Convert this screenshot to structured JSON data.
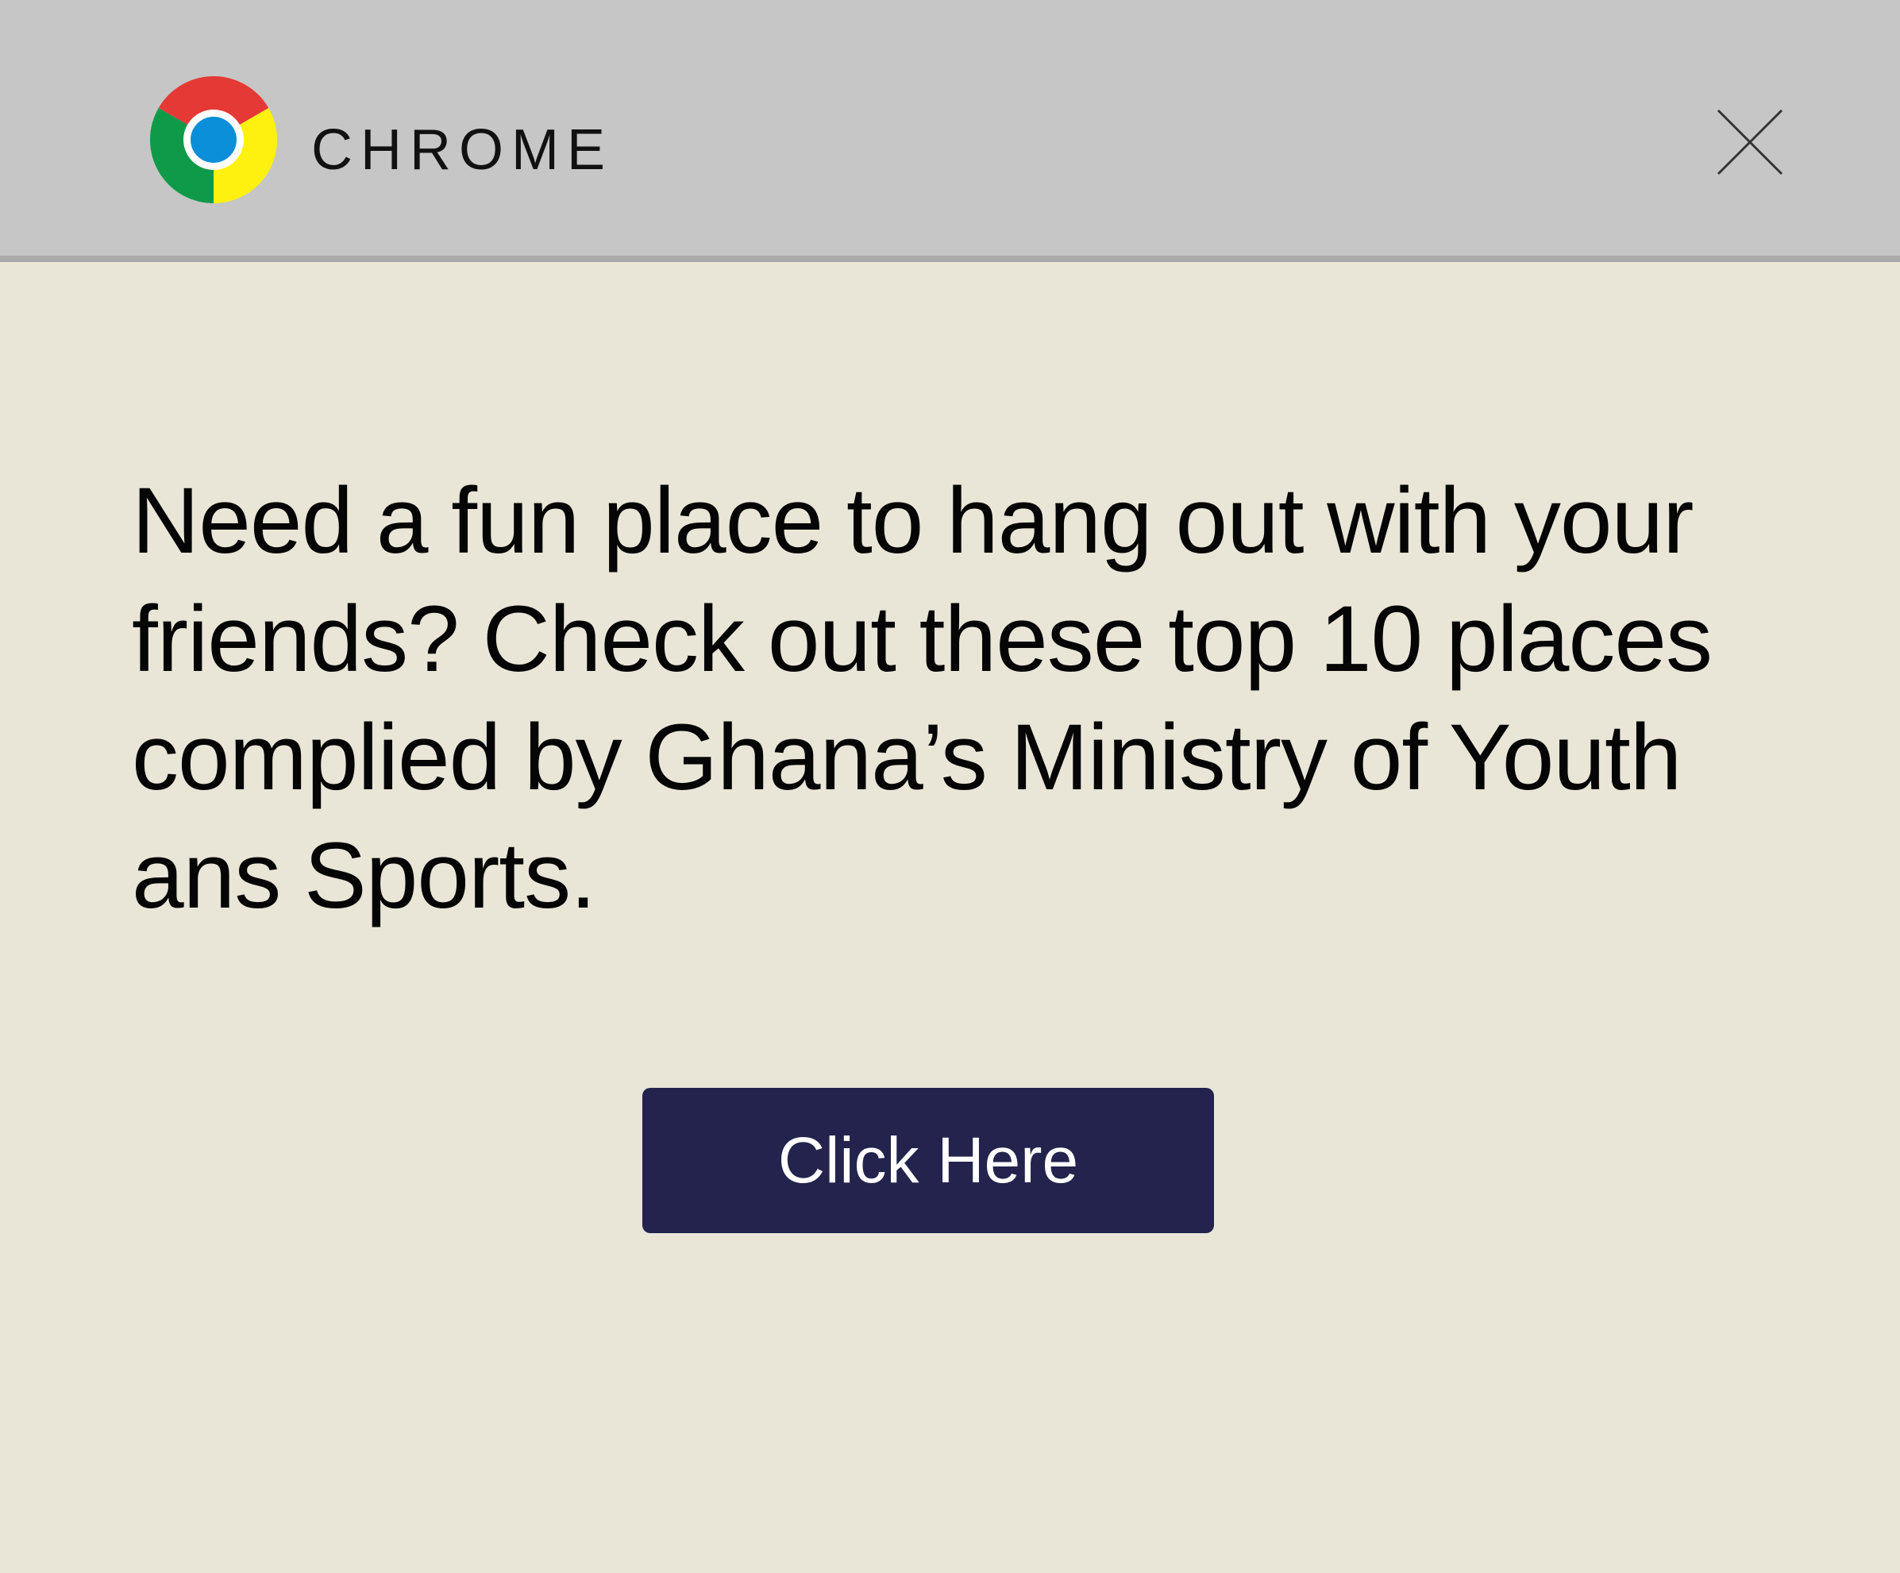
{
  "titlebar": {
    "app_name": "CHROME",
    "logo_icon": "chrome-logo-icon",
    "close_icon": "close-icon"
  },
  "popup": {
    "message": "Need a fun place to hang out with your friends? Check out these top 10 places complied by Ghana’s Ministry of Youth ans Sports.",
    "button_label": "Click Here"
  },
  "colors": {
    "titlebar_background": "#c6c6c6",
    "body_background": "#e9e6d8",
    "button_background": "#23234e",
    "button_text": "#ffffff",
    "logo_red": "#e53935",
    "logo_yellow": "#fff10f",
    "logo_green": "#0f9a4a",
    "logo_blue": "#0a8fd8"
  }
}
